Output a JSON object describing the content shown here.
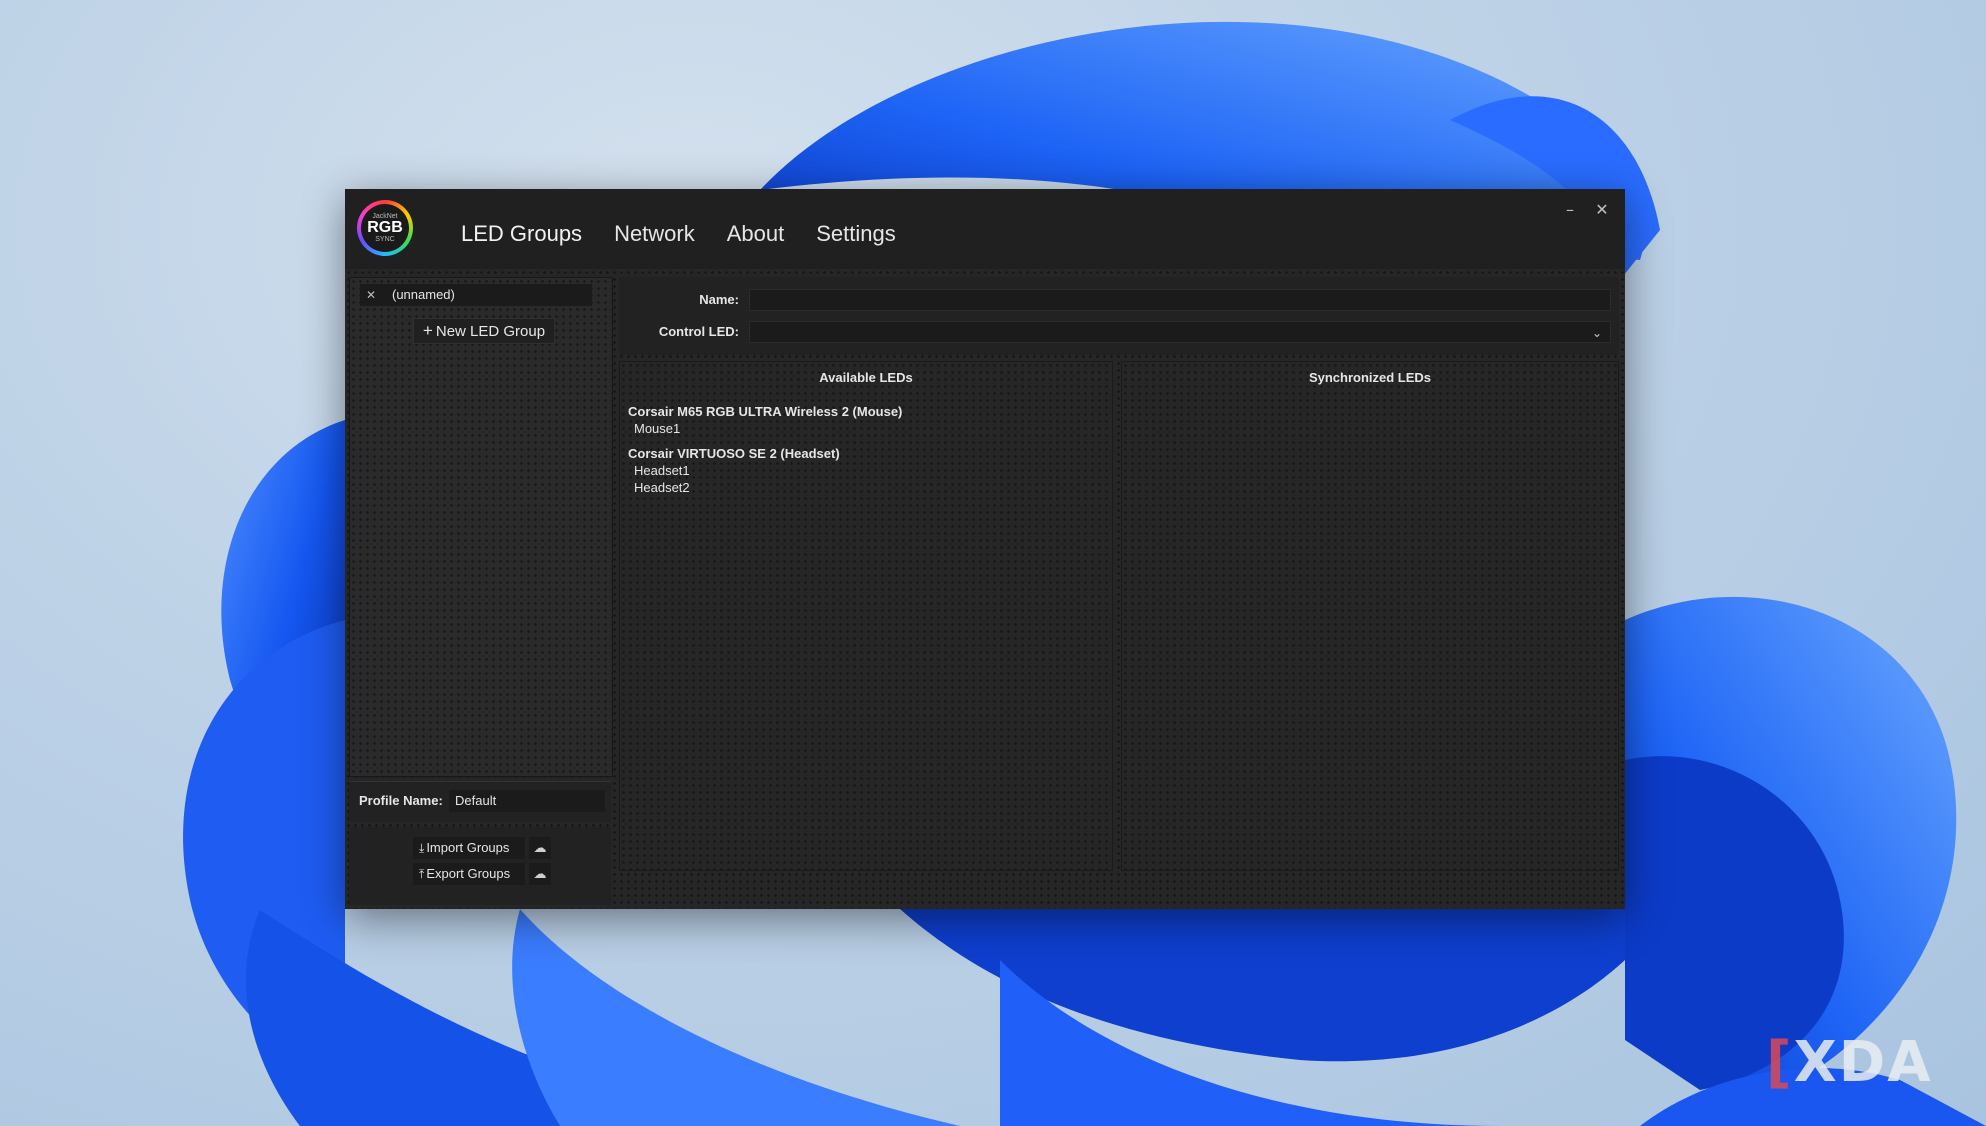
{
  "window": {
    "logo": {
      "line1": "JackNet",
      "line2": "RGB",
      "line3": "SYNC"
    },
    "nav": [
      {
        "label": "LED Groups",
        "active": true
      },
      {
        "label": "Network",
        "active": false
      },
      {
        "label": "About",
        "active": false
      },
      {
        "label": "Settings",
        "active": false
      }
    ],
    "minimize_glyph": "–",
    "close_glyph": "✕"
  },
  "sidebar": {
    "groups": [
      {
        "label": "(unnamed)",
        "remove_icon": "close-icon"
      }
    ],
    "new_group_label": "New LED Group",
    "profile_label": "Profile Name:",
    "profile_value": "Default",
    "import_label": "Import Groups",
    "export_label": "Export Groups"
  },
  "form": {
    "name_label": "Name:",
    "name_value": "",
    "control_led_label": "Control LED:",
    "control_led_value": ""
  },
  "available": {
    "title": "Available LEDs",
    "devices": [
      {
        "name": "Corsair M65 RGB ULTRA Wireless 2 (Mouse)",
        "leds": [
          "Mouse1"
        ]
      },
      {
        "name": "Corsair VIRTUOSO SE 2 (Headset)",
        "leds": [
          "Headset1",
          "Headset2"
        ]
      }
    ]
  },
  "synchronized": {
    "title": "Synchronized LEDs"
  },
  "watermark": {
    "text": "XDA"
  },
  "colors": {
    "window_bg": "#1c1c1c",
    "titlebar_bg": "#202020",
    "panel_bg": "#262626",
    "text": "#e6e6e6",
    "wallpaper_blue": "#1a5cff"
  }
}
